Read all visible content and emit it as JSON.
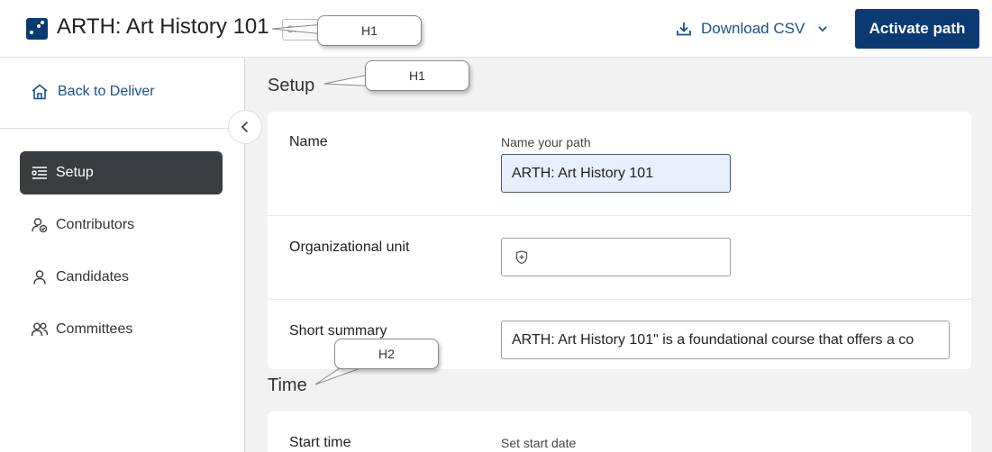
{
  "header": {
    "title": "ARTH: Art History 101",
    "title_stub_text": "Cr",
    "download_label": "Download CSV",
    "activate_label": "Activate path"
  },
  "sidebar": {
    "back_label": "Back to Deliver",
    "items": [
      {
        "label": "Setup",
        "icon": "setup-list-icon",
        "active": true
      },
      {
        "label": "Contributors",
        "icon": "contributor-user-check-icon",
        "active": false
      },
      {
        "label": "Candidates",
        "icon": "user-icon",
        "active": false
      },
      {
        "label": "Committees",
        "icon": "users-group-icon",
        "active": false
      }
    ]
  },
  "setup": {
    "title": "Setup",
    "name": {
      "label": "Name",
      "field_label": "Name your path",
      "value": "ARTH: Art History 101"
    },
    "org_unit": {
      "label": "Organizational unit",
      "value": ""
    },
    "summary": {
      "label": "Short summary",
      "value": "ARTH: Art History 101\" is a foundational course that offers a co"
    }
  },
  "time": {
    "title": "Time",
    "start": {
      "label": "Start time",
      "field_label": "Set start date"
    }
  },
  "callouts": {
    "header_tag": "H1",
    "setup_tag": "H1",
    "time_tag": "H2"
  },
  "colors": {
    "brand": "#0b3a73",
    "link": "#1a4f8f",
    "active_nav": "#3a3d40",
    "input_filled": "#e8eefb"
  }
}
